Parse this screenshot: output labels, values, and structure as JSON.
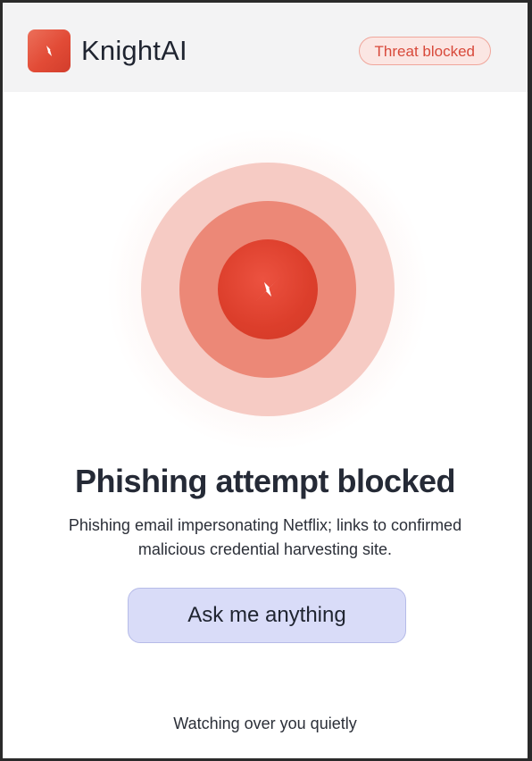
{
  "header": {
    "brand_name": "KnightAI",
    "status_badge": "Threat blocked"
  },
  "main": {
    "title": "Phishing attempt blocked",
    "description": "Phishing email impersonating Netflix; links to confirmed malicious credential harvesting site.",
    "ask_button_label": "Ask me anything"
  },
  "footer": {
    "status_text": "Watching over you quietly"
  },
  "icons": {
    "logo": "sparkle-star-icon",
    "center": "sparkle-star-icon"
  },
  "colors": {
    "accent": "#e24b36",
    "badge_text": "#d8493a",
    "badge_bg": "#fbe6e3",
    "button_bg": "#d9dcf8",
    "ring_outer": "#f6cbc4",
    "ring_middle": "#ec8877",
    "ring_inner": "#dc3e2b"
  }
}
